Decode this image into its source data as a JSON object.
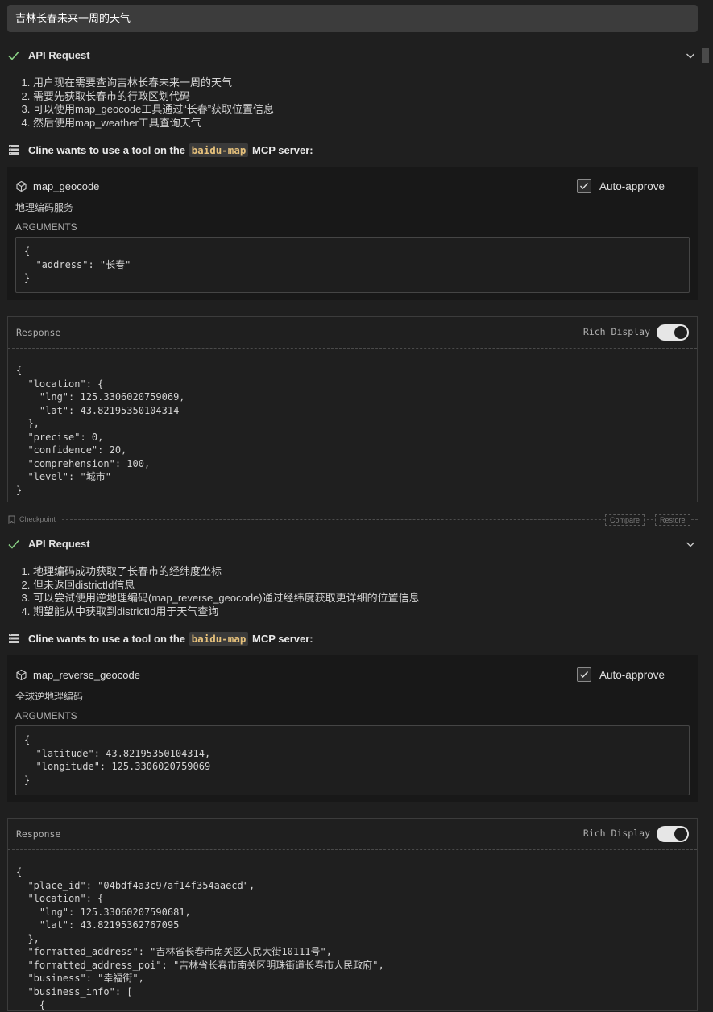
{
  "task": {
    "title": "吉林长春未来一周的天气"
  },
  "blocks": [
    {
      "api_title": "API Request",
      "steps": [
        "用户现在需要查询吉林长春未来一周的天气",
        "需要先获取长春市的行政区划代码",
        "可以使用map_geocode工具通过“长春”获取位置信息",
        "然后使用map_weather工具查询天气"
      ],
      "mcp": {
        "prefix": "Cline wants to use a tool on the",
        "server": "baidu-map",
        "suffix": "MCP server:"
      },
      "tool": {
        "name": "map_geocode",
        "description": "地理编码服务",
        "auto_approve": "Auto-approve",
        "args_label": "ARGUMENTS",
        "arguments": "{\n  \"address\": \"长春\"\n}"
      },
      "response": {
        "label": "Response",
        "rich_display": "Rich Display",
        "body": "{\n  \"location\": {\n    \"lng\": 125.3306020759069,\n    \"lat\": 43.82195350104314\n  },\n  \"precise\": 0,\n  \"confidence\": 20,\n  \"comprehension\": 100,\n  \"level\": \"城市\"\n}"
      }
    },
    {
      "api_title": "API Request",
      "steps": [
        "地理编码成功获取了长春市的经纬度坐标",
        "但未返回districtId信息",
        "可以尝试使用逆地理编码(map_reverse_geocode)通过经纬度获取更详细的位置信息",
        "期望能从中获取到districtId用于天气查询"
      ],
      "mcp": {
        "prefix": "Cline wants to use a tool on the",
        "server": "baidu-map",
        "suffix": "MCP server:"
      },
      "tool": {
        "name": "map_reverse_geocode",
        "description": "全球逆地理编码",
        "auto_approve": "Auto-approve",
        "args_label": "ARGUMENTS",
        "arguments": "{\n  \"latitude\": 43.82195350104314,\n  \"longitude\": 125.3306020759069\n}"
      },
      "response": {
        "label": "Response",
        "rich_display": "Rich Display",
        "body": "{\n  \"place_id\": \"04bdf4a3c97af14f354aaecd\",\n  \"location\": {\n    \"lng\": 125.33060207590681,\n    \"lat\": 43.82195362767095\n  },\n  \"formatted_address\": \"吉林省长春市南关区人民大街10111号\",\n  \"formatted_address_poi\": \"吉林省长春市南关区明珠街道长春市人民政府\",\n  \"business\": \"幸福街\",\n  \"business_info\": [\n    {"
      }
    }
  ],
  "checkpoint": {
    "label": "Checkpoint",
    "compare": "Compare",
    "restore": "Restore"
  }
}
